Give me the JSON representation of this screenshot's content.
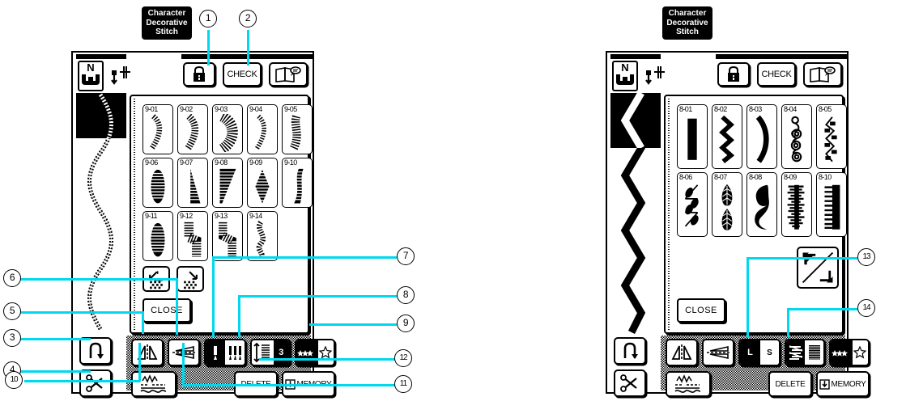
{
  "panels": [
    {
      "id": "left-panel",
      "title_tag": "Character\nDecorative\nStitch",
      "title_lines": [
        "Character",
        "Decorative",
        "Stitch"
      ],
      "presser_foot_label": "N",
      "top_buttons": [
        {
          "name": "lock-button",
          "label": "",
          "icon": "lock-icon"
        },
        {
          "name": "check-button",
          "label": "CHECK",
          "icon": ""
        },
        {
          "name": "manual-button",
          "label": "",
          "icon": "book-help-icon"
        }
      ],
      "stitch_group": "9",
      "stitches": [
        {
          "code": "9-01"
        },
        {
          "code": "9-02"
        },
        {
          "code": "9-03"
        },
        {
          "code": "9-04"
        },
        {
          "code": "9-05"
        },
        {
          "code": "9-06"
        },
        {
          "code": "9-07"
        },
        {
          "code": "9-08"
        },
        {
          "code": "9-09"
        },
        {
          "code": "9-10"
        },
        {
          "code": "9-11"
        },
        {
          "code": "9-12"
        },
        {
          "code": "9-13"
        },
        {
          "code": "9-14"
        }
      ],
      "page_buttons": [
        {
          "name": "page-prev-button",
          "icon": "arrow-up-left-icon"
        },
        {
          "name": "page-next-button",
          "icon": "arrow-down-right-icon"
        }
      ],
      "close_label": "CLOSE",
      "controls": {
        "reverse_label": "",
        "thread_cut_label": "",
        "mirror_v_label": "",
        "mirror_h_label": "",
        "needle_mode": {
          "single": "",
          "twin": ""
        },
        "stitch_length_value": "3",
        "pattern_star_label": "",
        "auto_thread_label": "",
        "delete_label": "DELETE",
        "memory_label": "MEMORY"
      }
    },
    {
      "id": "right-panel",
      "title_lines": [
        "Character",
        "Decorative",
        "Stitch"
      ],
      "presser_foot_label": "N",
      "top_buttons": [
        {
          "name": "lock-button",
          "label": "",
          "icon": "lock-icon"
        },
        {
          "name": "check-button",
          "label": "CHECK",
          "icon": ""
        },
        {
          "name": "manual-button",
          "label": "",
          "icon": "book-help-icon"
        }
      ],
      "stitch_group": "8",
      "stitches": [
        {
          "code": "8-01"
        },
        {
          "code": "8-02"
        },
        {
          "code": "8-03"
        },
        {
          "code": "8-04"
        },
        {
          "code": "8-05"
        },
        {
          "code": "8-06"
        },
        {
          "code": "8-07"
        },
        {
          "code": "8-08"
        },
        {
          "code": "8-09"
        },
        {
          "code": "8-10"
        }
      ],
      "resize_button": {
        "name": "resize-button",
        "icon": "diagonal-resize-icon"
      },
      "close_label": "CLOSE",
      "controls": {
        "size_toggle": {
          "large": "L",
          "small": "S",
          "selected": "L"
        },
        "density_toggle": {
          "name": "stitch-density-button"
        },
        "pattern_star_label": "",
        "delete_label": "DELETE",
        "memory_label": "MEMORY"
      }
    }
  ],
  "callouts": [
    {
      "num": "1",
      "glyph": "①",
      "target": "lock-button"
    },
    {
      "num": "2",
      "glyph": "②",
      "target": "check-button"
    },
    {
      "num": "3",
      "glyph": "③",
      "target": "reverse-stitch-button"
    },
    {
      "num": "4",
      "glyph": "④",
      "target": "thread-cutter-button"
    },
    {
      "num": "5",
      "glyph": "⑤",
      "target": "mirror-vertical-button"
    },
    {
      "num": "6",
      "glyph": "⑥",
      "target": "mirror-horizontal-button"
    },
    {
      "num": "7",
      "glyph": "⑦",
      "target": "needle-mode-button"
    },
    {
      "num": "8",
      "glyph": "⑧",
      "target": "stitch-length-button"
    },
    {
      "num": "9",
      "glyph": "⑨",
      "target": "pattern-star-button"
    },
    {
      "num": "10",
      "glyph": "⑩",
      "target": "auto-thread-button"
    },
    {
      "num": "11",
      "glyph": "⑪",
      "target": "delete-button"
    },
    {
      "num": "12",
      "glyph": "⑫",
      "target": "memory-button"
    },
    {
      "num": "13",
      "glyph": "⑬",
      "target": "size-toggle-button"
    },
    {
      "num": "14",
      "glyph": "⑭",
      "target": "density-toggle-button"
    }
  ],
  "colors": {
    "leader": "#00d8ef",
    "ink": "#000000",
    "paper": "#ffffff"
  }
}
